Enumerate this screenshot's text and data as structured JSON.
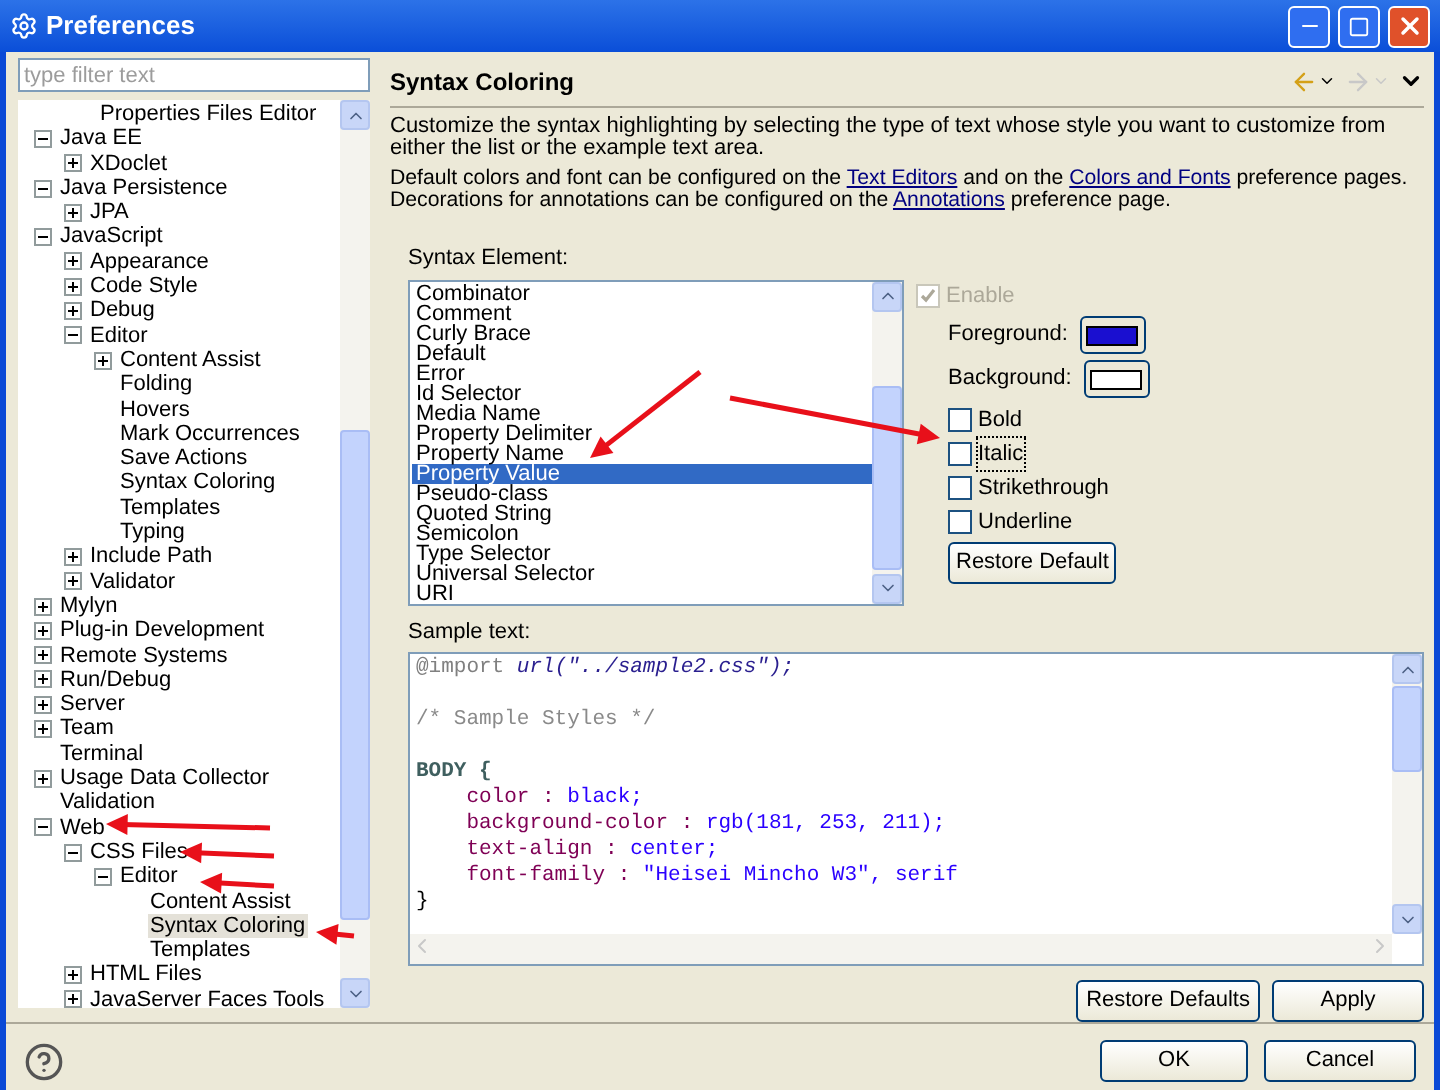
{
  "window": {
    "title": "Preferences"
  },
  "filter": {
    "placeholder": "type filter text"
  },
  "tree": {
    "cut_top": [
      {
        "label": "Properties Files Editor",
        "selected": false
      }
    ],
    "items": [
      {
        "label": "Java EE",
        "selected": false,
        "expanded": true,
        "children": [
          {
            "label": "XDoclet",
            "selected": false,
            "expanded": false
          }
        ]
      },
      {
        "label": "Java Persistence",
        "selected": false,
        "expanded": true,
        "children": [
          {
            "label": "JPA",
            "selected": false,
            "expanded": false
          }
        ]
      },
      {
        "label": "JavaScript",
        "selected": false,
        "expanded": true,
        "children": [
          {
            "label": "Appearance",
            "selected": false,
            "expanded": false
          },
          {
            "label": "Code Style",
            "selected": false,
            "expanded": false
          },
          {
            "label": "Debug",
            "selected": false,
            "expanded": false
          },
          {
            "label": "Editor",
            "selected": false,
            "expanded": true,
            "children": [
              {
                "label": "Content Assist",
                "selected": false,
                "expanded": false
              },
              {
                "label": "Folding",
                "selected": false
              },
              {
                "label": "Hovers",
                "selected": false
              },
              {
                "label": "Mark Occurrences",
                "selected": false
              },
              {
                "label": "Save Actions",
                "selected": false
              },
              {
                "label": "Syntax Coloring",
                "selected": false
              },
              {
                "label": "Templates",
                "selected": false
              },
              {
                "label": "Typing",
                "selected": false
              }
            ]
          },
          {
            "label": "Include Path",
            "selected": false,
            "expanded": false
          },
          {
            "label": "Validator",
            "selected": false,
            "expanded": false
          }
        ]
      },
      {
        "label": "Mylyn",
        "selected": false,
        "expanded": false
      },
      {
        "label": "Plug-in Development",
        "selected": false,
        "expanded": false
      },
      {
        "label": "Remote Systems",
        "selected": false,
        "expanded": false
      },
      {
        "label": "Run/Debug",
        "selected": false,
        "expanded": false
      },
      {
        "label": "Server",
        "selected": false,
        "expanded": false
      },
      {
        "label": "Team",
        "selected": false,
        "expanded": false
      },
      {
        "label": "Terminal",
        "selected": false
      },
      {
        "label": "Usage Data Collector",
        "selected": false,
        "expanded": false
      },
      {
        "label": "Validation",
        "selected": false
      },
      {
        "label": "Web",
        "selected": false,
        "expanded": true,
        "children": [
          {
            "label": "CSS Files",
            "selected": false,
            "expanded": true,
            "children": [
              {
                "label": "Editor",
                "selected": false,
                "expanded": true,
                "children": [
                  {
                    "label": "Content Assist",
                    "selected": false
                  },
                  {
                    "label": "Syntax Coloring",
                    "selected": true
                  },
                  {
                    "label": "Templates",
                    "selected": false
                  }
                ]
              }
            ]
          },
          {
            "label": "HTML Files",
            "selected": false,
            "expanded": false
          },
          {
            "label": "JavaServer Faces Tools",
            "selected": false,
            "expanded": false
          }
        ]
      }
    ]
  },
  "page": {
    "title": "Syntax Coloring",
    "intro": "Customize the syntax highlighting by selecting the type of text whose style you want to customize from either the list or the example text area.",
    "links_line1": [
      "Default colors and font can be configured on the ",
      "Text Editors",
      " and on the ",
      "Colors and Fonts",
      " preference pages."
    ],
    "links_line2": [
      "Decorations for annotations can be configured on the ",
      "Annotations",
      " preference page."
    ],
    "element_label": "Syntax Element:",
    "elements": [
      {
        "label": "Combinator",
        "selected": false
      },
      {
        "label": "Comment",
        "selected": false
      },
      {
        "label": "Curly Brace",
        "selected": false
      },
      {
        "label": "Default",
        "selected": false
      },
      {
        "label": "Error",
        "selected": false
      },
      {
        "label": "Id Selector",
        "selected": false
      },
      {
        "label": "Media Name",
        "selected": false
      },
      {
        "label": "Property Delimiter",
        "selected": false
      },
      {
        "label": "Property Name",
        "selected": false
      },
      {
        "label": "Property Value",
        "selected": true
      },
      {
        "label": "Pseudo-class",
        "selected": false
      },
      {
        "label": "Quoted String",
        "selected": false
      },
      {
        "label": "Semicolon",
        "selected": false
      },
      {
        "label": "Type Selector",
        "selected": false
      },
      {
        "label": "Universal Selector",
        "selected": false
      },
      {
        "label": "URI",
        "selected": false
      }
    ],
    "enable": {
      "label": "Enable",
      "checked": true,
      "disabled": true
    },
    "foreground": {
      "label": "Foreground:",
      "color": "#1a0fd0"
    },
    "background": {
      "label": "Background:",
      "color": "#ffffff"
    },
    "styles": [
      {
        "label": "Bold",
        "checked": false
      },
      {
        "label": "Italic",
        "checked": false
      },
      {
        "label": "Strikethrough",
        "checked": false
      },
      {
        "label": "Underline",
        "checked": false
      }
    ],
    "restore_default": "Restore Default",
    "sample_label": "Sample text:",
    "sample_lines": [
      {
        "kind": "code",
        "tokens": [
          {
            "text": "@import ",
            "kind": "atrule"
          },
          {
            "text": "url(\"../sample2.css\");",
            "kind": "uri"
          }
        ]
      },
      {
        "kind": "blank"
      },
      {
        "kind": "code",
        "tokens": [
          {
            "text": "/* Sample Styles */",
            "kind": "comment"
          }
        ]
      },
      {
        "kind": "blank"
      },
      {
        "kind": "code",
        "tokens": [
          {
            "text": "BODY {",
            "kind": "selector"
          }
        ]
      },
      {
        "kind": "code",
        "tokens": [
          {
            "text": "    color : ",
            "kind": "property"
          },
          {
            "text": "black;",
            "kind": "value"
          }
        ]
      },
      {
        "kind": "code",
        "tokens": [
          {
            "text": "    background-color : ",
            "kind": "property"
          },
          {
            "text": "rgb(181, 253, 211);",
            "kind": "value"
          }
        ]
      },
      {
        "kind": "code",
        "tokens": [
          {
            "text": "    text-align : ",
            "kind": "property"
          },
          {
            "text": "center;",
            "kind": "value"
          }
        ]
      },
      {
        "kind": "code",
        "tokens": [
          {
            "text": "    font-family : ",
            "kind": "property"
          },
          {
            "text": "\"Heisei Mincho W3\", serif",
            "kind": "value"
          }
        ]
      },
      {
        "kind": "code",
        "tokens": [
          {
            "text": "}",
            "kind": "plain"
          }
        ]
      }
    ],
    "restore_defaults": "Restore Defaults",
    "apply": "Apply"
  },
  "buttons": {
    "ok": "OK",
    "cancel": "Cancel"
  }
}
